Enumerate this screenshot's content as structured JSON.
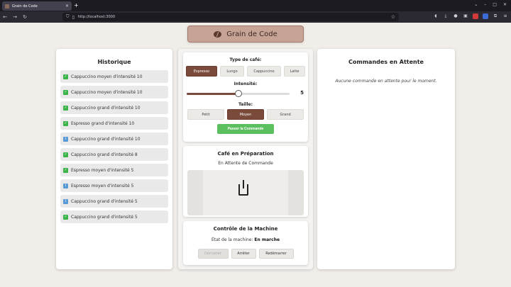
{
  "browser": {
    "tab_title": "Grain de Code",
    "url": "http://localhost:3000"
  },
  "brand": {
    "title": "Grain de Code"
  },
  "history": {
    "title": "Historique",
    "items": [
      {
        "status": "done",
        "text": "Cappuccino moyen d'intensité 10"
      },
      {
        "status": "done",
        "text": "Cappuccino moyen d'intensité 10"
      },
      {
        "status": "done",
        "text": "Cappuccino grand d'intensité 10"
      },
      {
        "status": "done",
        "text": "Espresso grand d'intensité 10"
      },
      {
        "status": "info",
        "text": "Cappuccino grand d'intensité 10"
      },
      {
        "status": "done",
        "text": "Cappuccino grand d'intensité 8"
      },
      {
        "status": "done",
        "text": "Espresso moyen d'intensité 5"
      },
      {
        "status": "info",
        "text": "Espresso moyen d'intensité 5"
      },
      {
        "status": "info",
        "text": "Cappuccino grand d'intensité 5"
      },
      {
        "status": "done",
        "text": "Cappuccino grand d'intensité 5"
      }
    ]
  },
  "order": {
    "type_label": "Type de café:",
    "types": [
      "Espresso",
      "Lungo",
      "Cappuccino",
      "Latte"
    ],
    "selected_type": "Espresso",
    "intensity_label": "Intensité:",
    "intensity": 5,
    "intensity_max": 10,
    "size_label": "Taille:",
    "sizes": [
      "Petit",
      "Moyen",
      "Grand"
    ],
    "selected_size": "Moyen",
    "submit_label": "Passer la Commande"
  },
  "preparation": {
    "title": "Café en Préparation",
    "status": "En Attente de Commande"
  },
  "machine": {
    "title": "Contrôle de la Machine",
    "state_label": "État de la machine:",
    "state_value": "En marche",
    "buttons": [
      "Démarrer",
      "Arrêter",
      "Redémarrer"
    ]
  },
  "queue": {
    "title": "Commandes en Attente",
    "empty_message": "Aucune commande en attente pour le moment."
  }
}
